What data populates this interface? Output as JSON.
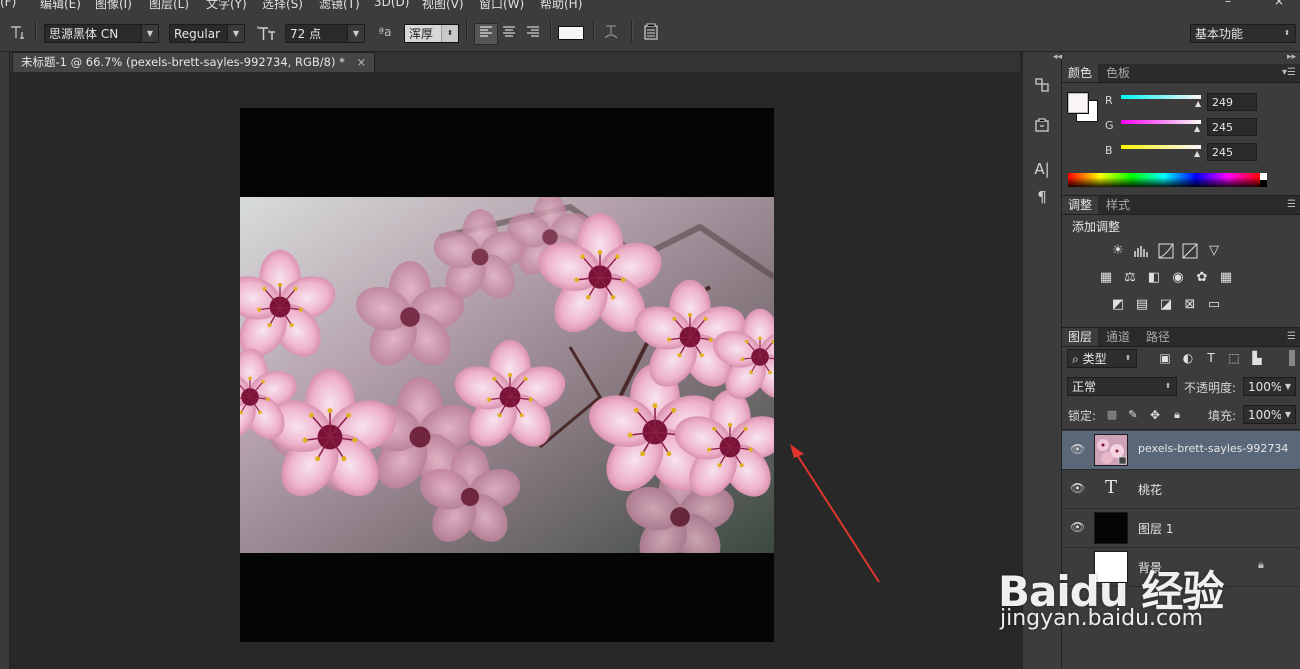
{
  "menu": {
    "items": [
      "(F)",
      "编辑(E)",
      "图像(I)",
      "图层(L)",
      "文字(Y)",
      "选择(S)",
      "滤镜(T)",
      "3D(D)",
      "视图(V)",
      "窗口(W)",
      "帮助(H)"
    ],
    "window_controls": [
      "–",
      "×"
    ]
  },
  "options_bar": {
    "font_family": "思源黑体 CN",
    "font_style": "Regular",
    "font_size": "72 点",
    "antialias": "浑厚",
    "text_color": "#f5f5f5",
    "workspace": "基本功能"
  },
  "document": {
    "tab_title": "未标题-1 @ 66.7% (pexels-brett-sayles-992734, RGB/8) *",
    "close_glyph": "×"
  },
  "color_panel": {
    "tabs": [
      "颜色",
      "色板"
    ],
    "foreground": "#f9f5f5",
    "background": "#ffffff",
    "channels": [
      {
        "label": "R",
        "value": "249"
      },
      {
        "label": "G",
        "value": "245"
      },
      {
        "label": "B",
        "value": "245"
      }
    ]
  },
  "adjustments_panel": {
    "tabs": [
      "调整",
      "样式"
    ],
    "heading": "添加调整"
  },
  "layers_panel": {
    "tabs": [
      "图层",
      "通道",
      "路径"
    ],
    "filter_label": "类型",
    "blend_mode": "正常",
    "opacity_label": "不透明度:",
    "opacity_value": "100%",
    "lock_label": "锁定:",
    "fill_label": "填充:",
    "fill_value": "100%",
    "layers": [
      {
        "name": "pexels-brett-sayles-992734",
        "type": "image",
        "selected": true
      },
      {
        "name": "桃花",
        "type": "text",
        "selected": false
      },
      {
        "name": "图层 1",
        "type": "fill-black",
        "selected": false
      },
      {
        "name": "背景",
        "type": "background",
        "selected": false
      }
    ]
  },
  "watermark": {
    "brand": "Baidu 经验",
    "url": "jingyan.baidu.com"
  }
}
